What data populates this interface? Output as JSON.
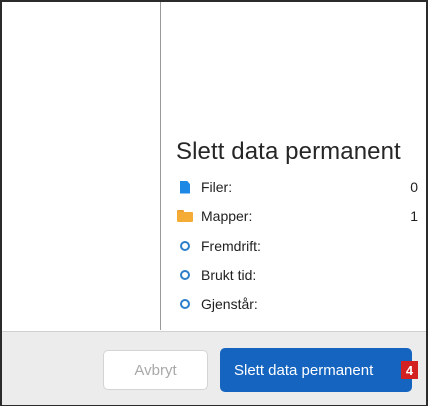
{
  "dialog": {
    "title": "Slett data permanent",
    "rows": [
      {
        "icon": "file-icon",
        "label": "Filer:",
        "value": "0"
      },
      {
        "icon": "folder-icon",
        "label": "Mapper:",
        "value": "1"
      },
      {
        "icon": "circle-icon",
        "label": "Fremdrift:",
        "value": ""
      },
      {
        "icon": "circle-icon",
        "label": "Brukt tid:",
        "value": ""
      },
      {
        "icon": "circle-icon",
        "label": "Gjenstår:",
        "value": ""
      }
    ]
  },
  "footer": {
    "cancel_label": "Avbryt",
    "confirm_label": "Slett data permanent",
    "step_badge": "4"
  },
  "colors": {
    "primary": "#1565c0",
    "badge": "#d32020",
    "file_icon": "#1e88e5",
    "folder_icon": "#f5ac36"
  }
}
